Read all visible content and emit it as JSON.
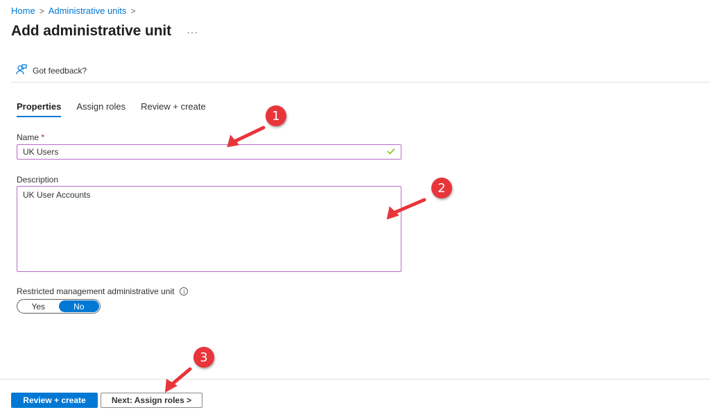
{
  "breadcrumb": {
    "items": [
      "Home",
      "Administrative units"
    ],
    "separator": ">"
  },
  "header": {
    "title": "Add administrative unit",
    "more_label": "···"
  },
  "feedback": {
    "icon": "feedback-person-icon",
    "label": "Got feedback?"
  },
  "tabs": [
    {
      "label": "Properties",
      "active": true
    },
    {
      "label": "Assign roles",
      "active": false
    },
    {
      "label": "Review + create",
      "active": false
    }
  ],
  "form": {
    "name_label": "Name",
    "required_mark": "*",
    "name_value": "UK Users",
    "name_valid_icon": "checkmark-icon",
    "description_label": "Description",
    "description_value": "UK User Accounts",
    "restricted_label": "Restricted management administrative unit",
    "info_icon_glyph": "i",
    "toggle_options": [
      "Yes",
      "No"
    ],
    "toggle_selected": "No"
  },
  "footer": {
    "primary_label": "Review + create",
    "secondary_label": "Next: Assign roles >"
  },
  "annotations": {
    "markers": [
      "1",
      "2",
      "3"
    ],
    "color": "#e8353a"
  },
  "colors": {
    "accent": "#0078d4",
    "input_focus_border": "#b66cc7",
    "valid_check": "#6bb700",
    "required": "#a4262c"
  }
}
